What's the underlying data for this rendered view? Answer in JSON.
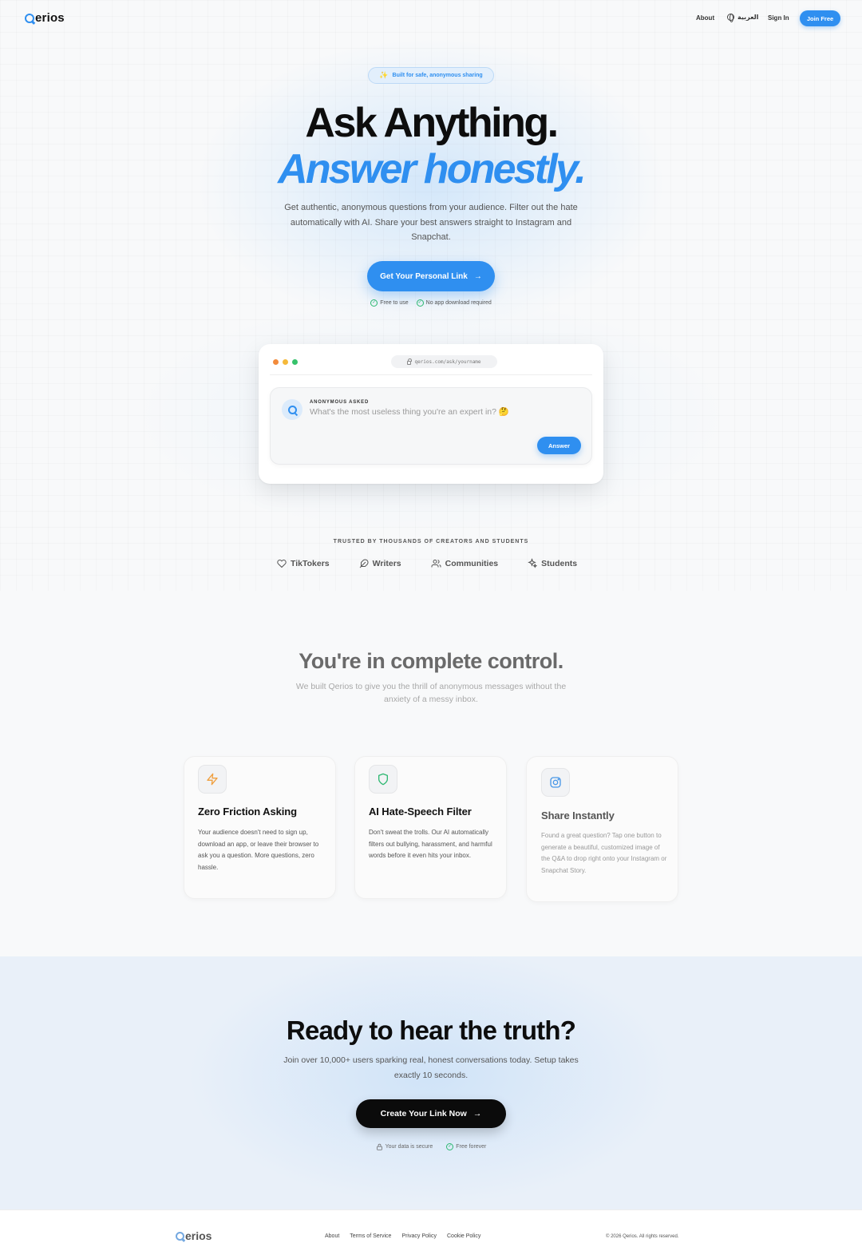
{
  "brand": {
    "name_rest": "erios",
    "accent": "#2f8ff0"
  },
  "nav": {
    "about": "About",
    "language": "العربية",
    "sign_in": "Sign In",
    "join": "Join Free"
  },
  "hero": {
    "pill": "Built for safe, anonymous sharing",
    "title_line1": "Ask Anything.",
    "title_line2": "Answer honestly.",
    "subtitle": "Get authentic, anonymous questions from your audience. Filter out the hate automatically with AI. Share your best answers straight to Instagram and Snapchat.",
    "cta": "Get Your Personal Link",
    "checks": [
      "Free to use",
      "No app download required"
    ]
  },
  "mock": {
    "url": "qerios.com/ask/yourname",
    "label": "ANONYMOUS ASKED",
    "question": "What's the most useless thing you're an expert in? 🤔",
    "answer_button": "Answer"
  },
  "trusted": {
    "heading": "TRUSTED BY THOUSANDS OF CREATORS AND STUDENTS",
    "audiences": [
      {
        "label": "TikTokers",
        "icon": "heart-icon"
      },
      {
        "label": "Writers",
        "icon": "feather-icon"
      },
      {
        "label": "Communities",
        "icon": "users-icon"
      },
      {
        "label": "Students",
        "icon": "sparkles-icon"
      }
    ]
  },
  "control": {
    "title": "You're in complete control.",
    "subtitle": "We built Qerios to give you the thrill of anonymous messages without the anxiety of a messy inbox."
  },
  "features": [
    {
      "title": "Zero Friction Asking",
      "body": "Your audience doesn't need to sign up, download an app, or leave their browser to ask you a question. More questions, zero hassle.",
      "icon": "zap-icon",
      "icon_color": "#f0a040"
    },
    {
      "title": "AI Hate-Speech Filter",
      "body": "Don't sweat the trolls. Our AI automatically filters out bullying, harassment, and harmful words before it even hits your inbox.",
      "icon": "shield-icon",
      "icon_color": "#2eb872"
    },
    {
      "title": "Share Instantly",
      "body": "Found a great question? Tap one button to generate a beautiful, customized image of the Q&A to drop right onto your Instagram or Snapchat Story.",
      "icon": "instagram-icon",
      "icon_color": "#4a98e8"
    }
  ],
  "cta_section": {
    "title": "Ready to hear the truth?",
    "subtitle": "Join over 10,000+ users sparking real, honest conversations today. Setup takes exactly 10 seconds.",
    "button": "Create Your Link Now",
    "checks": [
      "Your data is secure",
      "Free forever"
    ]
  },
  "footer": {
    "links": [
      "About",
      "Terms of Service",
      "Privacy Policy",
      "Cookie Policy"
    ],
    "copyright": "© 2026 Qerios. All rights reserved."
  }
}
